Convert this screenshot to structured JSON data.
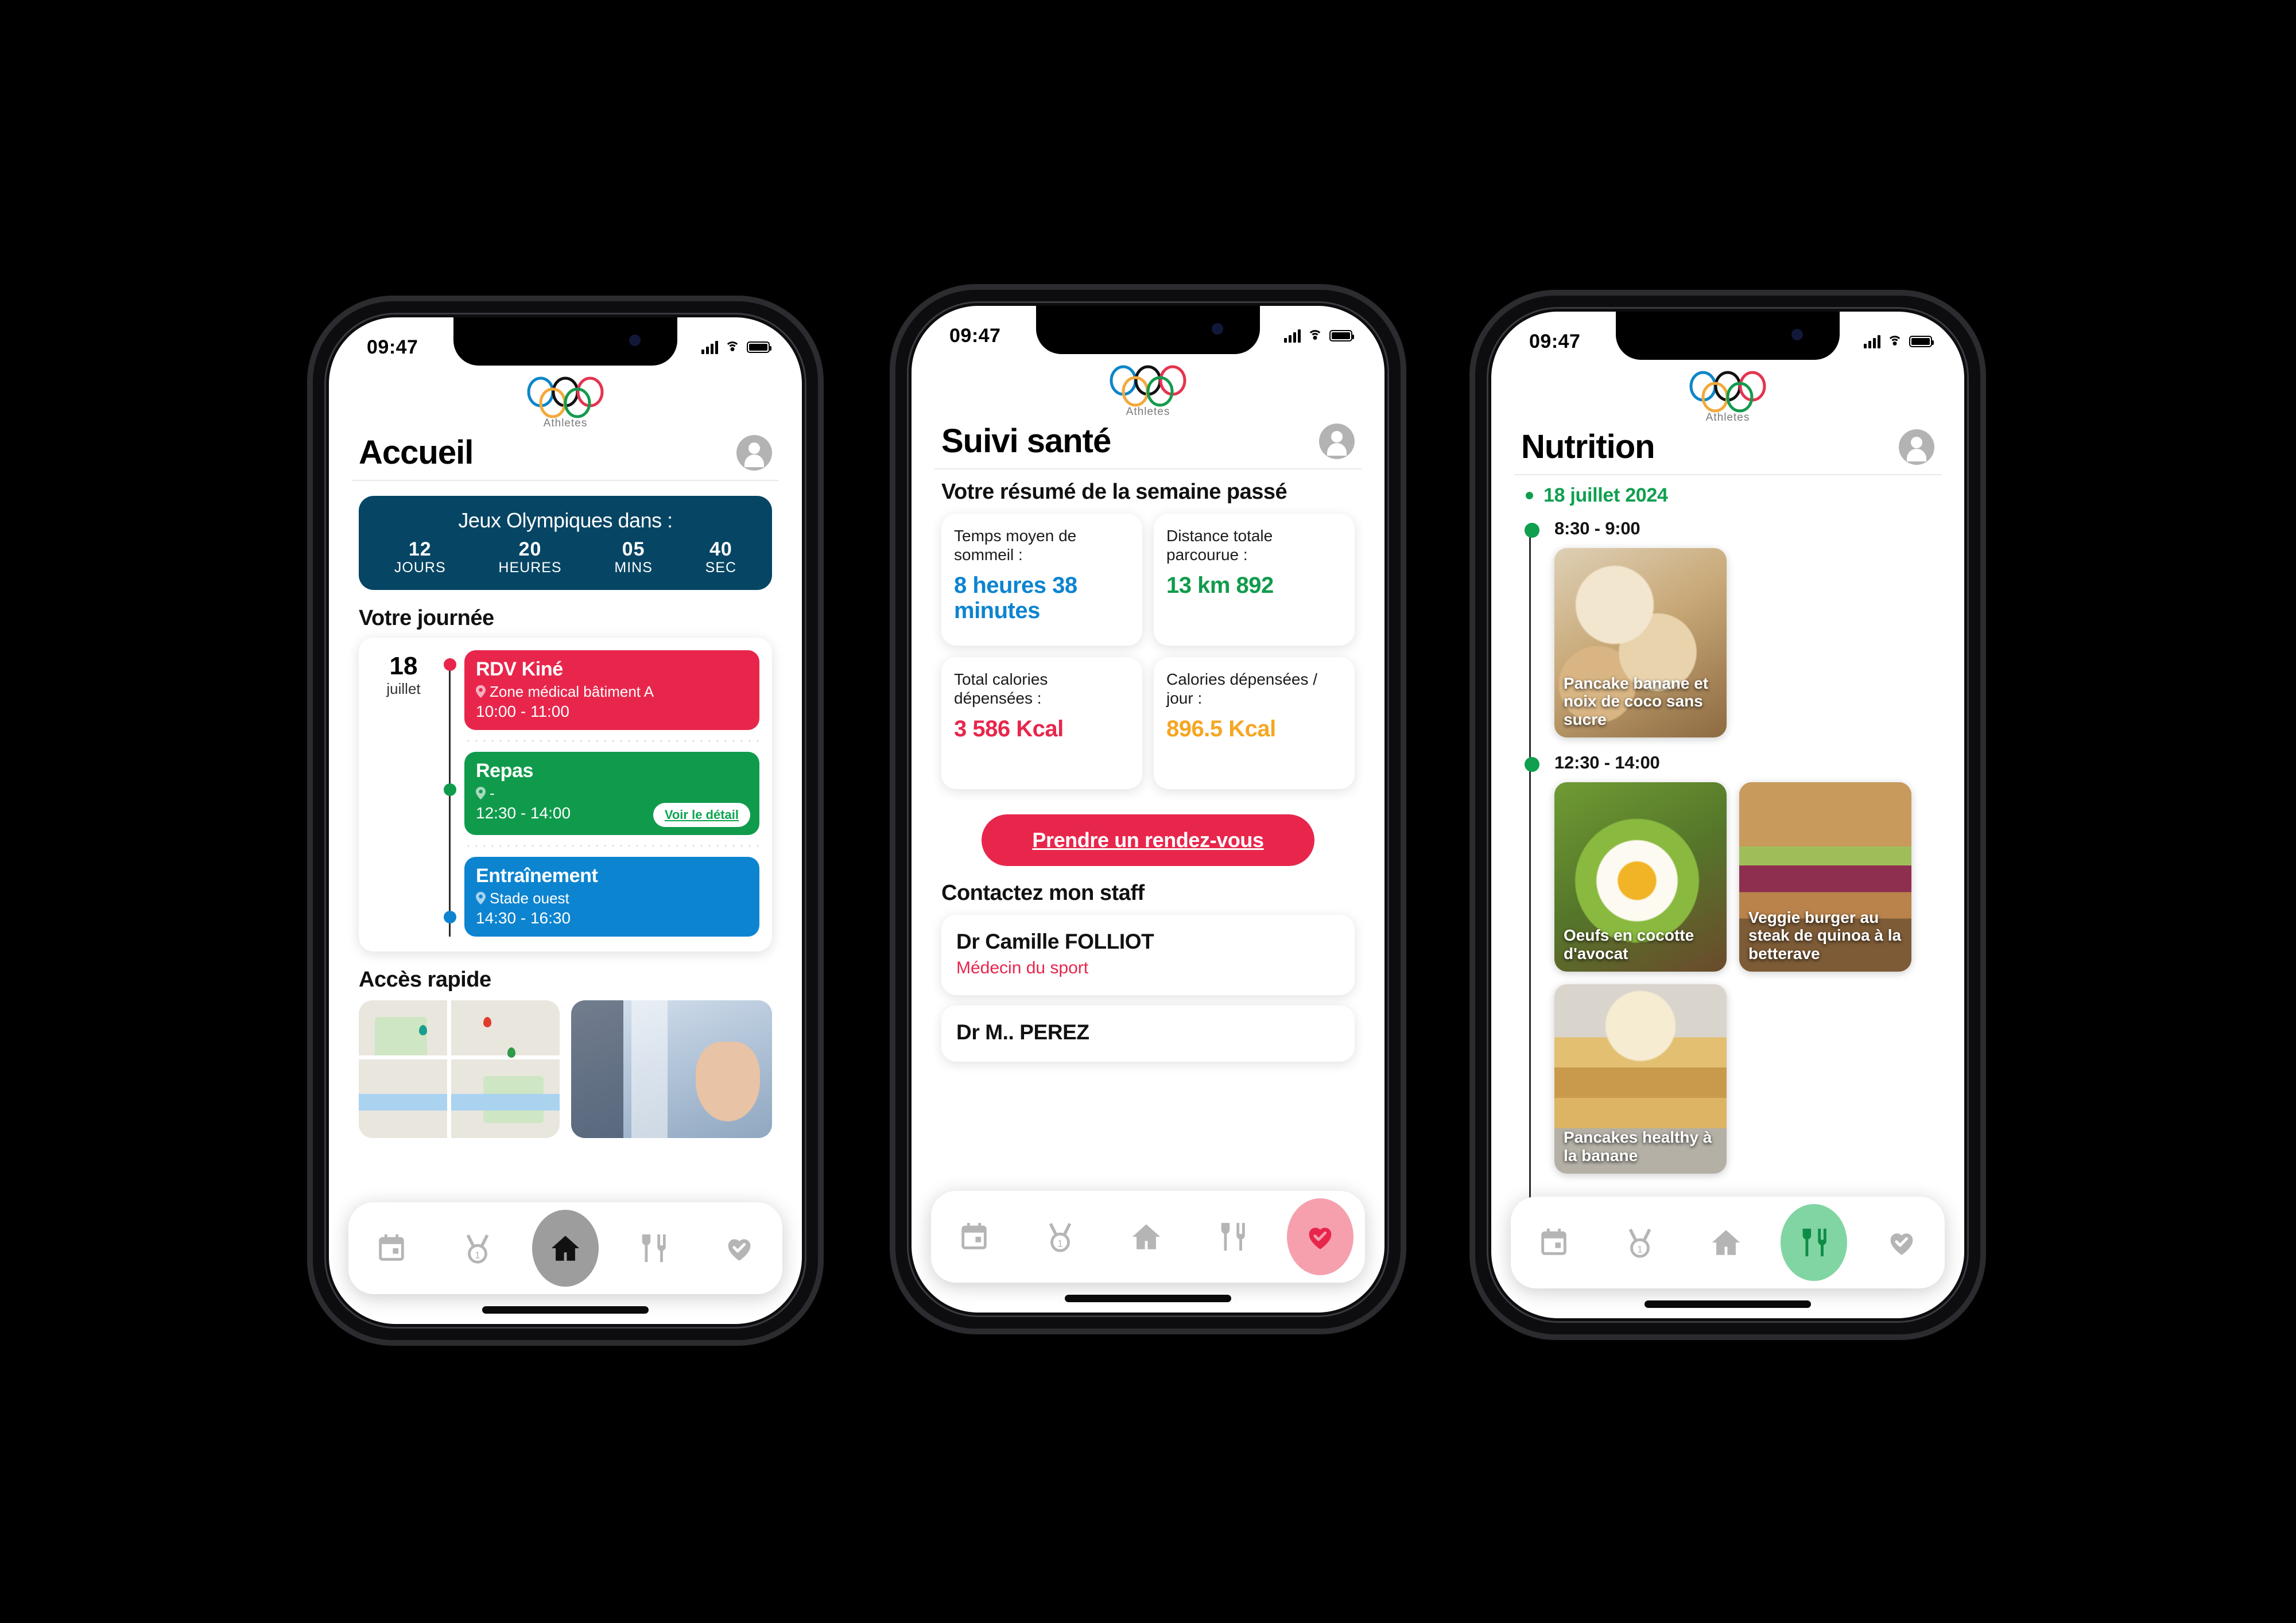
{
  "brand": {
    "logo_name": "olympic-rings-logo",
    "logo_subtitle": "Athletes",
    "colors": {
      "deep_teal": "#064564",
      "red": "#E8264C",
      "green": "#109B4C",
      "blue": "#0D84D0",
      "amber": "#F5A623",
      "nav_gray": "#B5B5B5"
    }
  },
  "status_bar": {
    "time": "09:47",
    "signal": "signal-icon",
    "wifi": "wifi-icon",
    "battery": "battery-icon"
  },
  "nav": {
    "items": [
      {
        "name": "calendar",
        "label": "Calendrier"
      },
      {
        "name": "medal",
        "label": "Médailles",
        "badge": "1"
      },
      {
        "name": "home",
        "label": "Accueil"
      },
      {
        "name": "nutrition",
        "label": "Nutrition"
      },
      {
        "name": "health",
        "label": "Santé"
      }
    ]
  },
  "phone1": {
    "title": "Accueil",
    "countdown": {
      "title": "Jeux Olympiques dans :",
      "cells": [
        {
          "value": "12",
          "label": "JOURS"
        },
        {
          "value": "20",
          "label": "HEURES"
        },
        {
          "value": "05",
          "label": "MINS"
        },
        {
          "value": "40",
          "label": "SEC"
        }
      ]
    },
    "day_section_title": "Votre journée",
    "day": {
      "number": "18",
      "month": "juillet"
    },
    "events": [
      {
        "title": "RDV Kiné",
        "location": "Zone médical bâtiment A",
        "time": "10:00 - 11:00",
        "color": "#E8264C",
        "button": null
      },
      {
        "title": "Repas",
        "location": "-",
        "time": "12:30 - 14:00",
        "color": "#109B4C",
        "button": "Voir le détail"
      },
      {
        "title": "Entraînement",
        "location": "Stade ouest",
        "time": "14:30 - 16:30",
        "color": "#0D84D0",
        "button": null
      }
    ],
    "quick_section_title": "Accès rapide",
    "quick_cards": [
      {
        "name": "map-card"
      },
      {
        "name": "clinic-card"
      }
    ],
    "active_nav": "home"
  },
  "phone2": {
    "title": "Suivi santé",
    "summary_title": "Votre résumé de la semaine passé",
    "stats": [
      {
        "label": "Temps moyen de sommeil :",
        "value": "8 heures 38 minutes",
        "color": "#0D84D0"
      },
      {
        "label": "Distance totale parcourue :",
        "value": "13 km 892",
        "color": "#109B4C"
      },
      {
        "label": "Total calories dépensées :",
        "value": "3 586 Kcal",
        "color": "#E8264C"
      },
      {
        "label": "Calories dépensées / jour :",
        "value": "896.5 Kcal",
        "color": "#F5A623"
      }
    ],
    "cta": "Prendre un rendez-vous",
    "staff_title": "Contactez mon staff",
    "staff": [
      {
        "name": "Dr Camille FOLLIOT",
        "role": "Médecin du sport"
      },
      {
        "name": "Dr M.. PEREZ",
        "role": ""
      }
    ],
    "active_nav": "health"
  },
  "phone3": {
    "title": "Nutrition",
    "date": "18 juillet 2024",
    "slots": [
      {
        "time": "8:30 - 9:00",
        "meals": [
          {
            "name": "Pancake banane et noix de coco sans sucre",
            "photo": "ph-pancake-coco"
          }
        ]
      },
      {
        "time": "12:30 - 14:00",
        "meals": [
          {
            "name": "Oeufs en cocotte d'avocat",
            "photo": "ph-avocado"
          },
          {
            "name": "Veggie burger au steak de quinoa à la betterave",
            "photo": "ph-burger"
          },
          {
            "name": "Pancakes healthy à la banane",
            "photo": "ph-pancake-ban"
          }
        ]
      }
    ],
    "active_nav": "nutrition"
  }
}
